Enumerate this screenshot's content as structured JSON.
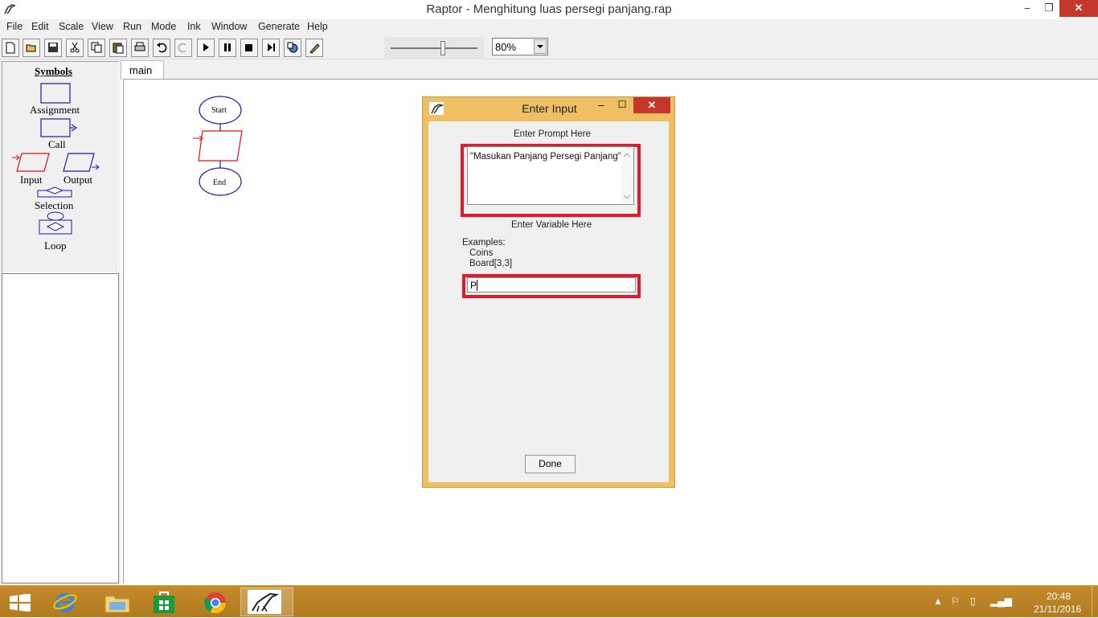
{
  "window": {
    "title": "Raptor - Menghitung luas persegi panjang.rap",
    "minimize": "–",
    "maximize": "❐",
    "close": "✕"
  },
  "menu": [
    "File",
    "Edit",
    "Scale",
    "View",
    "Run",
    "Mode",
    "Ink",
    "Window",
    "Generate",
    "Help"
  ],
  "toolbar": {
    "zoom_value": "80%",
    "zoom_level": 0.5
  },
  "symbols": {
    "title": "Symbols",
    "assignment": "Assignment",
    "call": "Call",
    "input": "Input",
    "output": "Output",
    "selection": "Selection",
    "loop": "Loop"
  },
  "tabs": [
    "main"
  ],
  "flowchart": {
    "start": "Start",
    "end": "End"
  },
  "dialog": {
    "title": "Enter Input",
    "prompt_label": "Enter Prompt Here",
    "prompt_value": "\"Masukan Panjang Persegi Panjang\"",
    "variable_label": "Enter Variable Here",
    "examples_label": "Examples:",
    "example_1": "Coins",
    "example_2": "Board[3,3]",
    "variable_value": "P",
    "done": "Done",
    "highlight_color": "#e3192b"
  },
  "taskbar": {
    "time": "20:48",
    "date": "21/11/2016"
  },
  "colors": {
    "accent": "#eebf63",
    "taskbar": "#b7801f",
    "flow_blue": "#1a1aa8",
    "flow_red": "#e01010"
  }
}
